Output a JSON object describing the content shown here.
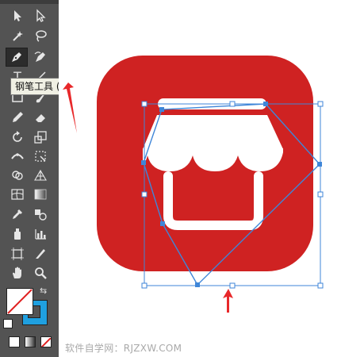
{
  "tooltip": {
    "text": "钢笔工具 (P)"
  },
  "watermark": {
    "text": "软件自学网：RJZXW.COM"
  },
  "colors": {
    "icon_red": "#cf2222",
    "path_blue": "#3f86d8",
    "annotation_red": "#e8282a",
    "toolbar_bg": "#535353",
    "stroke_swatch": "#1fa0e0"
  },
  "tools": [
    "selection-tool",
    "direct-selection-tool",
    "magic-wand-tool",
    "lasso-tool",
    "pen-tool",
    "curvature-tool",
    "type-tool",
    "line-segment-tool",
    "rectangle-tool",
    "paintbrush-tool",
    "pencil-tool",
    "eraser-tool",
    "rotate-tool",
    "scale-tool",
    "width-tool",
    "free-transform-tool",
    "shape-builder-tool",
    "graph-tool",
    "mesh-tool",
    "gradient-tool",
    "eyedropper-tool",
    "blend-tool",
    "symbol-sprayer-tool",
    "column-graph-tool",
    "artboard-tool",
    "slice-tool",
    "hand-tool",
    "zoom-tool"
  ]
}
